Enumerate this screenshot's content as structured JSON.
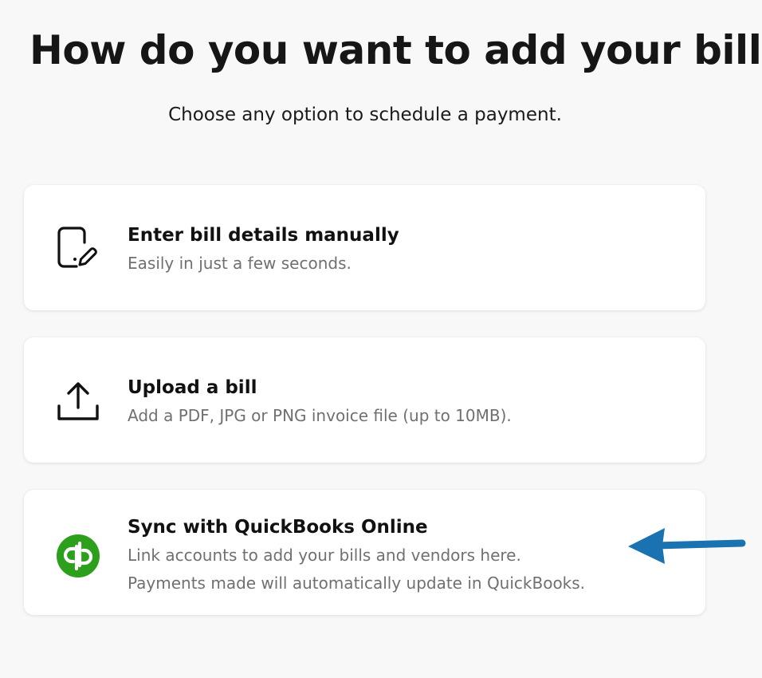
{
  "header": {
    "title": "How do you want to add your bill?",
    "subtitle": "Choose any option to schedule a payment."
  },
  "options": [
    {
      "icon": "document-edit-icon",
      "title": "Enter bill details manually",
      "description": "Easily in just a few seconds."
    },
    {
      "icon": "upload-icon",
      "title": "Upload a bill",
      "description": "Add a PDF, JPG or PNG invoice file (up to 10MB)."
    },
    {
      "icon": "quickbooks-logo-icon",
      "title": "Sync with QuickBooks Online",
      "description_lines": [
        "Link accounts to add your bills and vendors here.",
        "Payments made will automatically update in QuickBooks."
      ]
    }
  ],
  "annotation": {
    "icon": "arrow-left-icon",
    "color": "#1a73b0"
  },
  "colors": {
    "background": "#f8f8f8",
    "card": "#ffffff",
    "quickbooks_green": "#2ca01c",
    "annotation_blue": "#1a73b0"
  }
}
